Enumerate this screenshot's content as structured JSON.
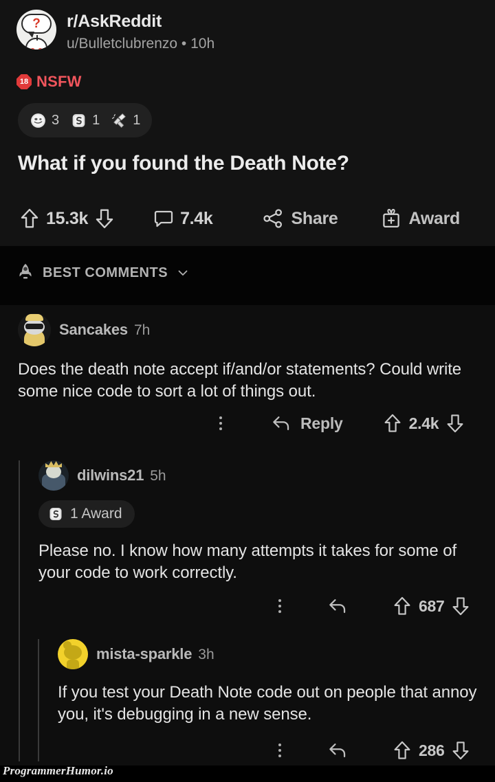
{
  "colors": {
    "page_bg": "#0b0b0b",
    "post_bg": "#131313",
    "sortbar_bg": "#040404",
    "comments_bg": "#0e0e0e",
    "nsfw_red": "#f0555c",
    "nsfw_badge_red": "#e13a3a",
    "text_primary": "#e9e9e9",
    "text_secondary": "#a4a4a4",
    "thread_line": "#3a3a3a",
    "mista_avatar_yellow": "#f2d12b"
  },
  "post": {
    "subreddit": "r/AskReddit",
    "meta": "u/Bulletclubrenzo • 10h",
    "author": "u/Bulletclubrenzo",
    "age": "10h",
    "avatar_icon": "askreddit-snoo-question-avatar",
    "avatar_question_mark": "?",
    "nsfw": {
      "badge_number": "18",
      "label": "NSFW"
    },
    "awards": [
      {
        "icon": "silver-coin-award-icon",
        "count": "3"
      },
      {
        "icon": "silver-s-award-icon",
        "count": "1"
      },
      {
        "icon": "clapping-hands-award-icon",
        "count": "1"
      }
    ],
    "title": "What if you found the Death Note?",
    "actions": {
      "upvote_icon": "upvote-arrow-icon",
      "score": "15.3k",
      "downvote_icon": "downvote-arrow-icon",
      "comment_icon": "comment-bubble-icon",
      "comment_count": "7.4k",
      "share_icon": "share-node-icon",
      "share_label": "Share",
      "award_icon": "gift-award-icon",
      "award_label": "Award"
    }
  },
  "sortbar": {
    "icon": "rocket-icon",
    "label": "BEST COMMENTS",
    "chevron_icon": "chevron-down-icon"
  },
  "comments": [
    {
      "id": "c1",
      "depth": 0,
      "author": "Sancakes",
      "age": "7h",
      "avatar_icon": "sancakes-snoo-sunglasses-avatar",
      "body": "Does the death note accept if/and/or statements? Could write some nice code to sort a lot of things out.",
      "awards": null,
      "actions": {
        "more_icon": "more-options-icon",
        "reply_icon": "reply-arrow-icon",
        "reply_label": "Reply",
        "upvote_icon": "upvote-arrow-icon",
        "score": "2.4k",
        "downvote_icon": "downvote-arrow-icon"
      }
    },
    {
      "id": "c2",
      "depth": 1,
      "author": "dilwins21",
      "age": "5h",
      "avatar_icon": "dilwins21-knight-avatar",
      "body": "Please no. I know how many attempts it takes for some of your code to work correctly.",
      "awards": {
        "icon": "silver-s-award-icon",
        "text": "1 Award"
      },
      "actions": {
        "more_icon": "more-options-icon",
        "reply_icon": "reply-arrow-icon",
        "reply_label": "",
        "upvote_icon": "upvote-arrow-icon",
        "score": "687",
        "downvote_icon": "downvote-arrow-icon"
      }
    },
    {
      "id": "c3",
      "depth": 2,
      "author": "mista-sparkle",
      "age": "3h",
      "avatar_icon": "mista-sparkle-snoo-avatar",
      "body": "If you test your Death Note code out on people that annoy you, it's debugging in a new sense.",
      "awards": null,
      "actions": {
        "more_icon": "more-options-icon",
        "reply_icon": "reply-arrow-icon",
        "reply_label": "",
        "upvote_icon": "upvote-arrow-icon",
        "score": "286",
        "downvote_icon": "downvote-arrow-icon"
      }
    }
  ],
  "watermark": "ProgrammerHumor.io"
}
